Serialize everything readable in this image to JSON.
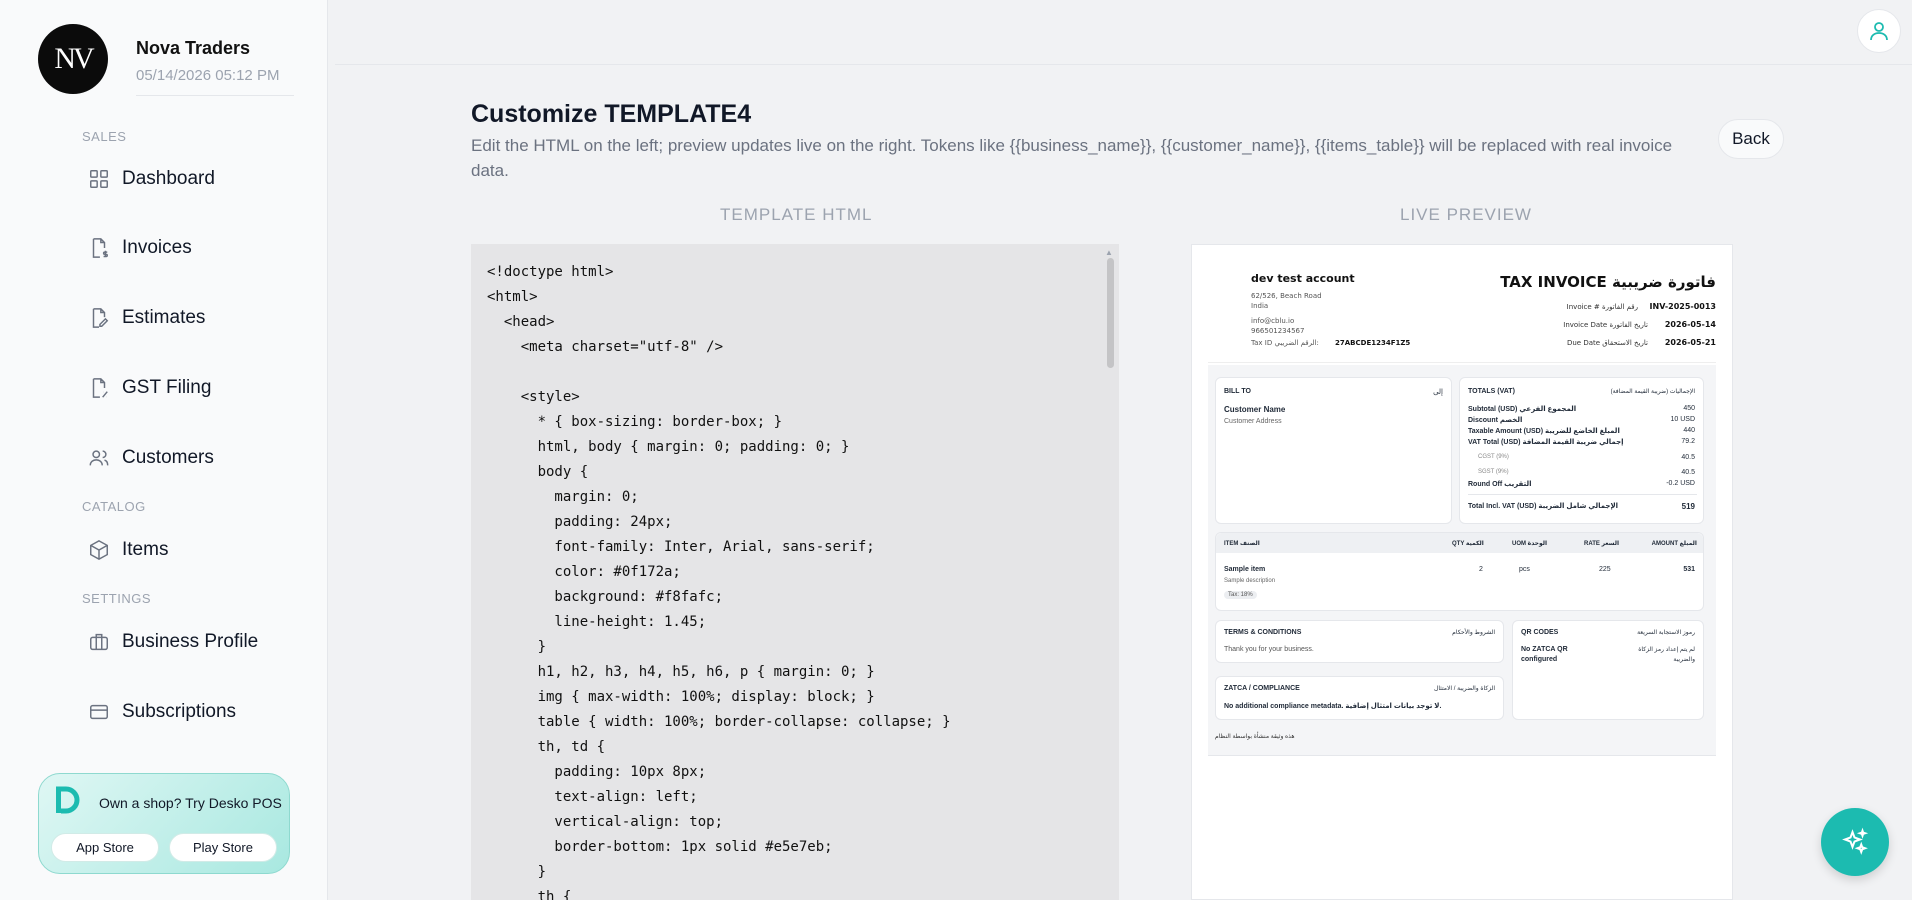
{
  "sidebar": {
    "logo_text": "NV",
    "business_name": "Nova Traders",
    "datetime": "05/14/2026 05:12 PM",
    "sections": {
      "sales": "SALES",
      "catalog": "CATALOG",
      "settings": "SETTINGS"
    },
    "items": [
      {
        "label": "Dashboard",
        "icon": "grid-icon"
      },
      {
        "label": "Invoices",
        "icon": "invoice-dollar-icon"
      },
      {
        "label": "Estimates",
        "icon": "estimate-edit-icon"
      },
      {
        "label": "GST Filing",
        "icon": "tax-percent-icon"
      },
      {
        "label": "Customers",
        "icon": "users-icon"
      },
      {
        "label": "Items",
        "icon": "box-icon"
      },
      {
        "label": "Business Profile",
        "icon": "briefcase-icon"
      },
      {
        "label": "Subscriptions",
        "icon": "credit-card-icon"
      }
    ],
    "promo": {
      "text": "Own a shop? Try Desko POS",
      "app_store": "App Store",
      "play_store": "Play Store",
      "accent": "#1cbbb0"
    }
  },
  "page": {
    "title": "Customize TEMPLATE4",
    "description": "Edit the HTML on the left; preview updates live on the right. Tokens like {{business_name}}, {{customer_name}}, {{items_table}} will be replaced with real invoice data.",
    "back_label": "Back",
    "editor_heading": "TEMPLATE HTML",
    "preview_heading": "LIVE PREVIEW"
  },
  "editor": {
    "code": "<!doctype html>\n<html>\n  <head>\n    <meta charset=\"utf-8\" />\n\n    <style>\n      * { box-sizing: border-box; }\n      html, body { margin: 0; padding: 0; }\n      body {\n        margin: 0;\n        padding: 24px;\n        font-family: Inter, Arial, sans-serif;\n        color: #0f172a;\n        background: #f8fafc;\n        line-height: 1.45;\n      }\n      h1, h2, h3, h4, h5, h6, p { margin: 0; }\n      img { max-width: 100%; display: block; }\n      table { width: 100%; border-collapse: collapse; }\n      th, td {\n        padding: 10px 8px;\n        text-align: left;\n        vertical-align: top;\n        border-bottom: 1px solid #e5e7eb;\n      }\n      th {"
  },
  "invoice": {
    "business": "dev test account",
    "address1": "62/526, Beach Road",
    "address2": "India",
    "email": "info@cblu.io",
    "phone": "966501234567",
    "tax_id_label": "Tax ID الرقم الضريبي:",
    "tax_id": "27ABCDE1234F1Z5",
    "title": "TAX INVOICE فاتورة ضريبية",
    "invoice_no_label": "Invoice # رقم الفاتورة",
    "invoice_no": "INV-2025-0013",
    "invoice_date_label": "Invoice Date تاريخ الفاتورة",
    "invoice_date": "2026-05-14",
    "due_date_label": "Due Date تاريخ الاستحقاق",
    "due_date": "2026-05-21",
    "bill_to": "BILL TO",
    "bill_to_ar": "إلى",
    "customer_name": "Customer Name",
    "customer_address": "Customer Address",
    "totals": "TOTALS (VAT)",
    "totals_ar": "الإجماليات (ضريبة القيمة المضافة)",
    "rows": [
      {
        "label": "Subtotal (USD) المجموع الفرعي",
        "value": "450"
      },
      {
        "label": "Discount الخصم",
        "value": "10 USD"
      },
      {
        "label": "Taxable Amount (USD) المبلغ الخاضع للضريبة",
        "value": "440"
      },
      {
        "label": "VAT Total (USD) إجمالي ضريبة القيمة المضافة",
        "value": "79.2"
      },
      {
        "label": "CGST (9%)",
        "value": "40.5"
      },
      {
        "label": "SGST (9%)",
        "value": "40.5"
      },
      {
        "label": "Round Off التقريب",
        "value": "-0.2 USD"
      }
    ],
    "grand_label": "Total Incl. VAT (USD) الإجمالي شامل الضريبة",
    "grand_value": "519",
    "table_headers": {
      "item": "ITEM الصنف",
      "qty": "QTY الكمية",
      "uom": "UOM الوحدة",
      "rate": "RATE السعر",
      "amount": "AMOUNT المبلغ"
    },
    "line": {
      "name": "Sample item",
      "desc": "Sample description",
      "tax": "Tax: 18%",
      "qty": "2",
      "uom": "pcs",
      "rate": "225",
      "amount": "531"
    },
    "terms": "TERMS & CONDITIONS",
    "terms_ar": "الشروط والأحكام",
    "terms_text": "Thank you for your business.",
    "qr": "QR CODES",
    "qr_ar": "رموز الاستجابة السريعة",
    "qr_text": "No ZATCA QR configured",
    "qr_text_ar": "لم يتم إعداد رمز الزكاة والضريبة",
    "zatca": "ZATCA / COMPLIANCE",
    "zatca_ar": "الزكاة والضريبة / الامتثال",
    "zatca_text": "No additional compliance metadata. لا توجد بيانات امتثال إضافية.",
    "footer": "هذه وثيقة منشأة بواسطة النظام"
  }
}
